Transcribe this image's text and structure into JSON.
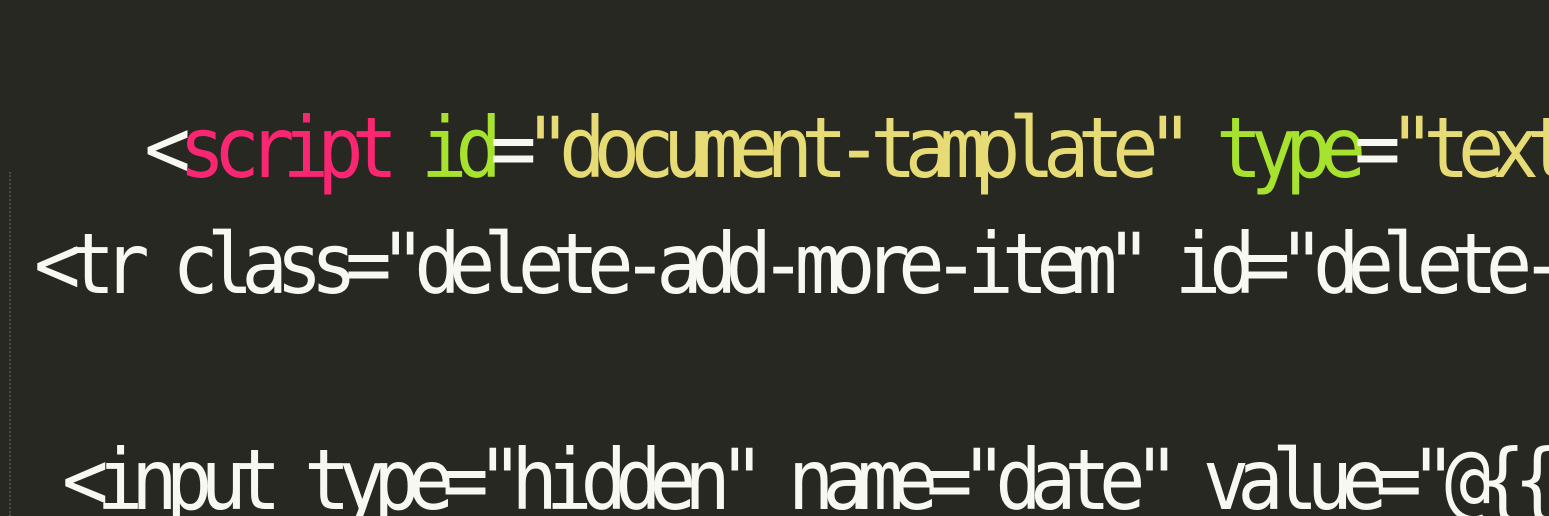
{
  "editor": {
    "colors": {
      "background": "#272822",
      "tag": "#f92672",
      "attribute": "#a6e22e",
      "string": "#e6db74",
      "plain": "#f8f8f2"
    },
    "lines": [
      {
        "open": "<",
        "tag": "script",
        "sp1": " ",
        "attr1": "id",
        "eq1": "=",
        "val1": "\"document-tamplate\"",
        "sp2": " ",
        "attr2": "type",
        "eq2": "=",
        "val2": "\"text/x-handlebars-t"
      },
      {
        "text": "<tr class=\"delete-add-more-item\" id=\"delete-add-more-it"
      },
      {
        "text": "<input type=\"hidden\" name=\"date\" value=\"@{{date}}\" >"
      }
    ]
  }
}
